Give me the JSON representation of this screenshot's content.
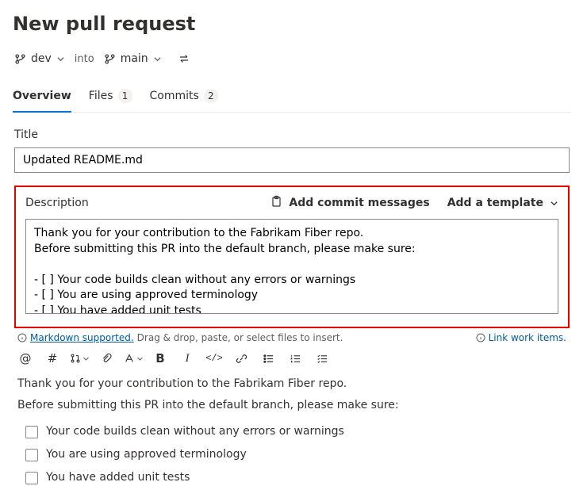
{
  "page": {
    "title": "New pull request"
  },
  "branches": {
    "source": "dev",
    "into": "into",
    "target": "main"
  },
  "tabs": {
    "overview": "Overview",
    "files": {
      "label": "Files",
      "count": "1"
    },
    "commits": {
      "label": "Commits",
      "count": "2"
    }
  },
  "form": {
    "title_label": "Title",
    "title_value": "Updated README.md",
    "desc_label": "Description",
    "add_commit_messages": "Add commit messages",
    "add_template": "Add a template",
    "description_text": "Thank you for your contribution to the Fabrikam Fiber repo.\nBefore submitting this PR into the default branch, please make sure:\n\n- [ ] Your code builds clean without any errors or warnings\n- [ ] You are using approved terminology\n- [ ] You have added unit tests"
  },
  "hints": {
    "markdown_supported": "Markdown supported.",
    "drag_drop": "Drag & drop, paste, or select files to insert.",
    "link_work": "Link work items."
  },
  "preview": {
    "line1": "Thank you for your contribution to the Fabrikam Fiber repo.",
    "line2": "Before submitting this PR into the default branch, please make sure:",
    "items": [
      "Your code builds clean without any errors or warnings",
      "You are using approved terminology",
      "You have added unit tests"
    ]
  }
}
